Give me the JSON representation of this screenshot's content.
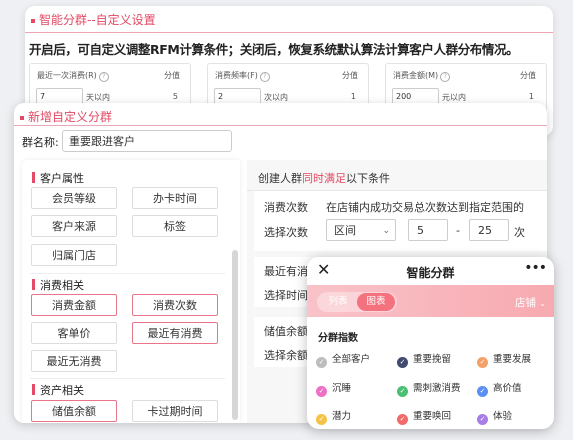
{
  "back": {
    "title": "智能分群--自定义设置",
    "desc": "开启后，可自定义调整RFM计算条件；关闭后，恢复系统默认算法计算客户人群分布情况。",
    "cards": [
      {
        "label": "最近一次消费(R)",
        "header": "分值",
        "input": "7",
        "unit": "天以内",
        "score": "5"
      },
      {
        "label": "消费频率(F)",
        "header": "分值",
        "input": "2",
        "unit": "次以内",
        "score": "1"
      },
      {
        "label": "消费金额(M)",
        "header": "分值",
        "input": "200",
        "unit": "元以内",
        "score": "1"
      }
    ]
  },
  "dialog": {
    "title": "新增自定义分群",
    "group_name_label": "群名称:",
    "group_name_value": "重要跟进客户",
    "sections": [
      {
        "name": "客户属性",
        "options": [
          "会员等级",
          "办卡时间",
          "客户来源",
          "标签",
          "归属门店"
        ]
      },
      {
        "name": "消费相关",
        "options": [
          "消费金额",
          "消费次数",
          "客单价",
          "最近有消费",
          "最近无消费"
        ]
      },
      {
        "name": "资产相关",
        "options": [
          "储值余额",
          "卡过期时间"
        ]
      }
    ],
    "right": {
      "head_pre": "创建人群",
      "head_hl": "同时满足",
      "head_post": "以下条件",
      "cond1": {
        "name": "消费次数",
        "desc": "在店铺内成功交易总次数达到指定范围的",
        "choose_label": "选择次数",
        "select": "区间",
        "from": "5",
        "dash": "-",
        "to": "25",
        "unit": "次"
      },
      "cond2": {
        "name": "最近有消",
        "choose_label": "选择时间"
      },
      "cond3": {
        "name": "储值余额",
        "choose_label": "选择余额"
      }
    }
  },
  "phone": {
    "title": "智能分群",
    "tabs": [
      "列表",
      "图表"
    ],
    "active_tab": "图表",
    "store": "店铺",
    "section": "分群指数",
    "chips": [
      {
        "label": "全部客户",
        "color": "#bdbdbd"
      },
      {
        "label": "重要挽留",
        "color": "#3f4a6e"
      },
      {
        "label": "重要发展",
        "color": "#f4a06b"
      },
      {
        "label": "沉睡",
        "color": "#ee6fc4"
      },
      {
        "label": "需刺激消费",
        "color": "#4bbf73"
      },
      {
        "label": "高价值",
        "color": "#5b8ff2"
      },
      {
        "label": "潜力",
        "color": "#f5c343"
      },
      {
        "label": "重要唤回",
        "color": "#f26a6a"
      },
      {
        "label": "体验",
        "color": "#a77de8"
      }
    ]
  }
}
